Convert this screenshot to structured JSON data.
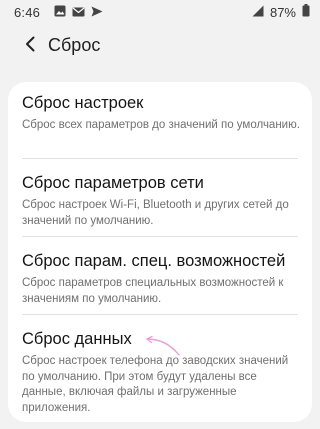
{
  "status_bar": {
    "time": "6:46",
    "battery": "87%",
    "left_icons": [
      "image-icon",
      "mail-icon",
      "send-icon"
    ],
    "right_icons": [
      "signal-icon",
      "battery-icon"
    ]
  },
  "header": {
    "back_icon": "back-arrow-icon",
    "title": "Сброс"
  },
  "items": [
    {
      "title": "Сброс настроек",
      "subtitle": "Сброс всех параметров до значений по умолчанию."
    },
    {
      "title": "Сброс параметров сети",
      "subtitle": "Сброс настроек Wi-Fi, Bluetooth и других сетей до значений по умолчанию."
    },
    {
      "title": "Сброс парам. спец. возможностей",
      "subtitle": "Сброс параметров специальных возможностей к значениям по умолчанию."
    },
    {
      "title": "Сброс данных",
      "subtitle": "Сброс настроек телефона до заводских значений по умолчанию. При этом будут удалены все данные, включая файлы и загруженные приложения."
    }
  ],
  "colors": {
    "background": "#f2f2f2",
    "card": "#ffffff",
    "title_text": "#151515",
    "subtitle_text": "#707070",
    "annotation_arrow": "#e8a0d6"
  }
}
